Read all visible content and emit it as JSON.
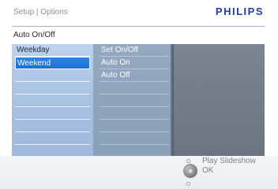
{
  "header": {
    "breadcrumb": "Setup | Options",
    "brand": "PHILIPS",
    "subtitle": "Auto On/Off"
  },
  "menu": {
    "col1": {
      "items": [
        "Weekday",
        "Weekend"
      ],
      "selected_index": 1,
      "rows": 8
    },
    "col2": {
      "items": [
        "Set On/Off",
        "Auto On",
        "Auto Off"
      ],
      "rows": 8
    }
  },
  "footer": {
    "play": "Play Slideshow",
    "ok": "OK"
  },
  "colors": {
    "brand": "#1f3f9a",
    "selected": "#1d6fd1",
    "header_rule": "#9fb7dd"
  }
}
